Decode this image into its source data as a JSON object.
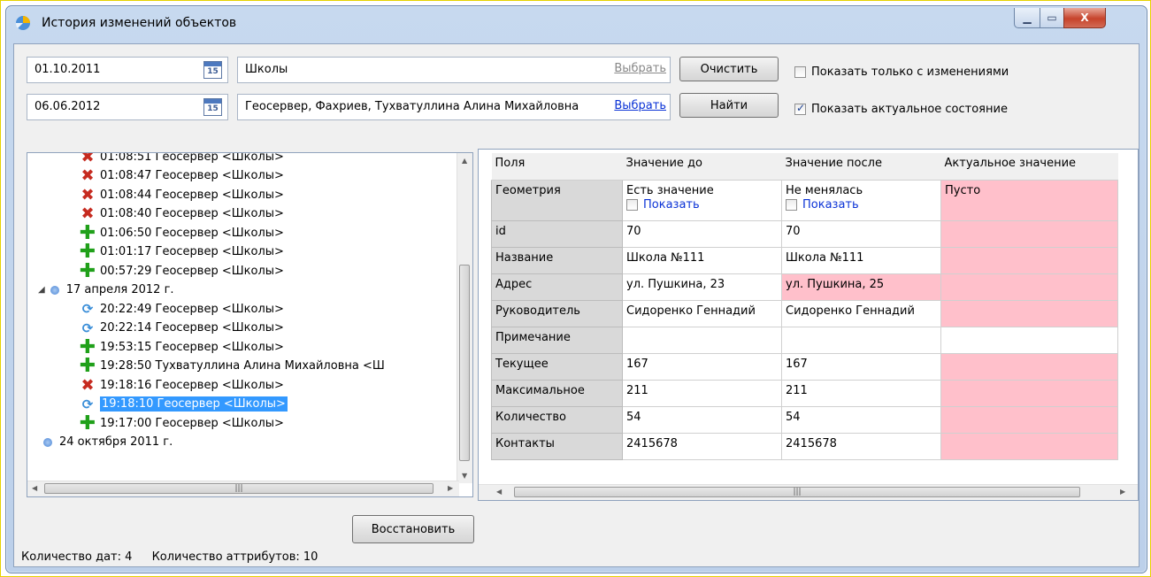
{
  "window": {
    "title": "История изменений объектов",
    "min_label": "▁",
    "max_label": "▭",
    "close_label": "X"
  },
  "filters": {
    "date_from": "01.10.2011",
    "date_to": "06.06.2012",
    "calendar_label": "15",
    "layer_value": "Школы",
    "layer_link": "Выбрать",
    "users_value": "Геосервер, Фахриев, Тухватуллина Алина Михайловна",
    "users_link": "Выбрать",
    "clear_label": "Очистить",
    "find_label": "Найти",
    "only_changes_label": "Показать только с изменениями",
    "only_changes_checked": false,
    "actual_state_label": "Показать актуальное состояние",
    "actual_state_checked": true
  },
  "tree": {
    "items": [
      {
        "type": "del",
        "text": "01:08:51 Геосервер <Школы>"
      },
      {
        "type": "del",
        "text": "01:08:47 Геосервер <Школы>"
      },
      {
        "type": "del",
        "text": "01:08:44 Геосервер <Школы>"
      },
      {
        "type": "del",
        "text": "01:08:40 Геосервер <Школы>"
      },
      {
        "type": "add",
        "text": "01:06:50 Геосервер <Школы>"
      },
      {
        "type": "add",
        "text": "01:01:17 Геосервер <Школы>"
      },
      {
        "type": "add",
        "text": "00:57:29 Геосервер <Школы>"
      },
      {
        "type": "date",
        "text": "17 апреля 2012 г."
      },
      {
        "type": "upd",
        "text": "20:22:49 Геосервер <Школы>"
      },
      {
        "type": "upd",
        "text": "20:22:14 Геосервер <Школы>"
      },
      {
        "type": "add",
        "text": "19:53:15 Геосервер <Школы>"
      },
      {
        "type": "add",
        "text": "19:28:50 Тухватуллина Алина Михайловна <Ш"
      },
      {
        "type": "del",
        "text": "19:18:16 Геосервер <Школы>"
      },
      {
        "type": "upd",
        "text": "19:18:10 Геосервер <Школы>",
        "selected": true
      },
      {
        "type": "add",
        "text": "19:17:00 Геосервер <Школы>"
      },
      {
        "type": "date",
        "text": "24 октября 2011 г."
      }
    ],
    "restore_label": "Восстановить"
  },
  "grid": {
    "headers": [
      "Поля",
      "Значение до",
      "Значение после",
      "Актуальное значение"
    ],
    "show_label": "Показать",
    "rows": [
      {
        "field": "Геометрия",
        "before": "Есть значение",
        "after": "Не менялась",
        "actual": "Пусто"
      },
      {
        "field": "id",
        "before": "70",
        "after": "70",
        "actual": ""
      },
      {
        "field": "Название",
        "before": "Школа №111",
        "after": "Школа №111",
        "actual": ""
      },
      {
        "field": "Адрес",
        "before": "ул. Пушкина, 23",
        "after": "ул. Пушкина, 25",
        "actual": ""
      },
      {
        "field": "Руководитель",
        "before": "Сидоренко Геннадий",
        "after": "Сидоренко Геннадий",
        "actual": ""
      },
      {
        "field": "Примечание",
        "before": "",
        "after": "",
        "actual": ""
      },
      {
        "field": "Текущее",
        "before": "167",
        "after": "167",
        "actual": ""
      },
      {
        "field": "Максимальное",
        "before": "211",
        "after": "211",
        "actual": ""
      },
      {
        "field": "Количество",
        "before": "54",
        "after": "54",
        "actual": ""
      },
      {
        "field": "Контакты",
        "before": "2415678",
        "after": "2415678",
        "actual": ""
      }
    ]
  },
  "status": {
    "dates_label": "Количество дат:",
    "dates_count": "4",
    "attrs_label": "Количество аттрибутов:",
    "attrs_count": "10"
  },
  "colors": {
    "highlight": "#ffc0cb",
    "selection": "#3399ff"
  }
}
